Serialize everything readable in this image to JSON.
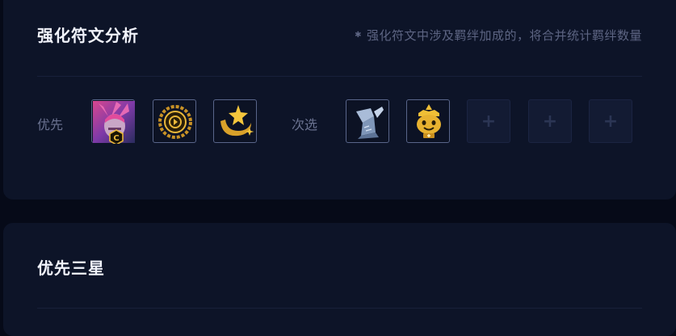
{
  "section_augments": {
    "title": "强化符文分析",
    "note": "强化符文中涉及羁绊加成的，将合并统计羁绊数量",
    "priority_label": "优先",
    "alternative_label": "次选",
    "priority_icons": [
      "champion-portrait-c-badge-icon",
      "gold-coin-ring-icon",
      "golden-star-swirl-icon"
    ],
    "alternative_icons": [
      "stone-hammer-icon",
      "golden-crowned-creature-icon"
    ],
    "empty_slot_symbol": "+"
  },
  "section_three_star": {
    "title": "优先三星"
  },
  "colors": {
    "background": "#060a18",
    "card": "#0d1428",
    "title": "#f1f3fb",
    "muted_text": "#5d6583",
    "gold_accent": "#e9b73a"
  }
}
